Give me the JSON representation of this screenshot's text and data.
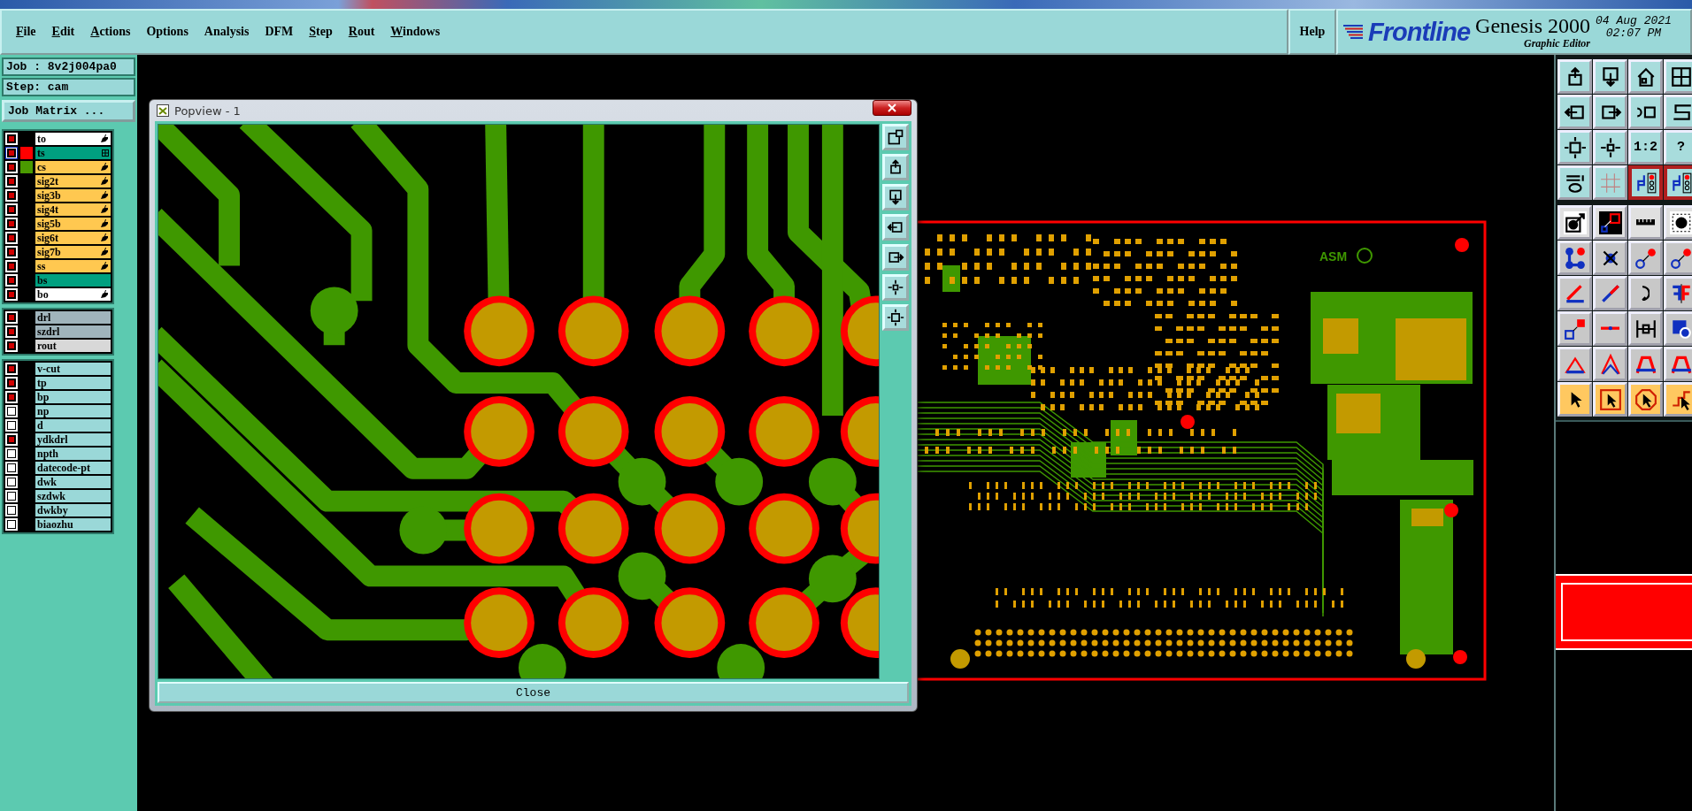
{
  "menu": {
    "items": [
      {
        "label": "File",
        "mnemonic": true
      },
      {
        "label": "Edit",
        "mnemonic": true
      },
      {
        "label": "Actions",
        "mnemonic": true
      },
      {
        "label": "Options",
        "mnemonic": false
      },
      {
        "label": "Analysis",
        "mnemonic": false
      },
      {
        "label": "DFM",
        "mnemonic": false
      },
      {
        "label": "Step",
        "mnemonic": true
      },
      {
        "label": "Rout",
        "mnemonic": true
      },
      {
        "label": "Windows",
        "mnemonic": true
      }
    ],
    "help": "Help"
  },
  "brand": {
    "logo": "Frontline",
    "product": "Genesis 2000",
    "module": "Graphic Editor",
    "date": "04 Aug 2021",
    "time": "02:07 PM"
  },
  "job": {
    "job_label": "Job : 8v2j004pa0",
    "step_label": "Step: cam",
    "matrix_button": "Job Matrix ..."
  },
  "layer_groups": [
    {
      "layers": [
        {
          "name": "to",
          "kind": "silk",
          "checked": true,
          "selected": false,
          "affected": true
        },
        {
          "name": "ts",
          "kind": "mask",
          "checked": true,
          "selected": true,
          "affected": false,
          "color": "#ff0000"
        },
        {
          "name": "cs",
          "kind": "signal",
          "checked": true,
          "selected": false,
          "affected": true,
          "color": "#4a9a00"
        },
        {
          "name": "sig2t",
          "kind": "signal",
          "checked": true,
          "selected": false,
          "affected": true
        },
        {
          "name": "sig3b",
          "kind": "signal",
          "checked": true,
          "selected": false,
          "affected": true
        },
        {
          "name": "sig4t",
          "kind": "signal",
          "checked": true,
          "selected": false,
          "affected": true
        },
        {
          "name": "sig5b",
          "kind": "signal",
          "checked": true,
          "selected": false,
          "affected": true
        },
        {
          "name": "sig6t",
          "kind": "signal",
          "checked": true,
          "selected": false,
          "affected": true
        },
        {
          "name": "sig7b",
          "kind": "signal",
          "checked": true,
          "selected": false,
          "affected": true
        },
        {
          "name": "ss",
          "kind": "signal",
          "checked": true,
          "selected": false,
          "affected": true
        },
        {
          "name": "bs",
          "kind": "mask",
          "checked": true,
          "selected": false,
          "affected": false
        },
        {
          "name": "bo",
          "kind": "silk",
          "checked": true,
          "selected": false,
          "affected": true
        }
      ]
    },
    {
      "layers": [
        {
          "name": "drl",
          "kind": "drill",
          "checked": true,
          "selected": false,
          "affected": false
        },
        {
          "name": "szdrl",
          "kind": "drill",
          "checked": true,
          "selected": false,
          "affected": false
        },
        {
          "name": "rout",
          "kind": "rout",
          "checked": true,
          "selected": false,
          "affected": false
        }
      ]
    },
    {
      "layers": [
        {
          "name": "v-cut",
          "kind": "document",
          "checked": true,
          "selected": false,
          "affected": false
        },
        {
          "name": "tp",
          "kind": "document",
          "checked": true,
          "selected": false,
          "affected": false
        },
        {
          "name": "bp",
          "kind": "document",
          "checked": true,
          "selected": false,
          "affected": false
        },
        {
          "name": "np",
          "kind": "document",
          "checked": false,
          "selected": false,
          "affected": false
        },
        {
          "name": "d",
          "kind": "document",
          "checked": false,
          "selected": false,
          "affected": false
        },
        {
          "name": "ydkdrl",
          "kind": "document",
          "checked": true,
          "selected": false,
          "affected": false
        },
        {
          "name": "npth",
          "kind": "document",
          "checked": false,
          "selected": false,
          "affected": false
        },
        {
          "name": "datecode-pt",
          "kind": "document",
          "checked": false,
          "selected": false,
          "affected": false
        },
        {
          "name": "dwk",
          "kind": "document",
          "checked": false,
          "selected": false,
          "affected": false
        },
        {
          "name": "szdwk",
          "kind": "document",
          "checked": false,
          "selected": false,
          "affected": false
        },
        {
          "name": "dwkby",
          "kind": "document",
          "checked": false,
          "selected": false,
          "affected": false
        },
        {
          "name": "biaozhu",
          "kind": "document",
          "checked": false,
          "selected": false,
          "affected": false
        }
      ]
    }
  ],
  "popview": {
    "title": "Popview - 1",
    "close_button": "Close"
  },
  "board": {
    "marking": "ASM"
  },
  "toolbar": [
    {
      "kind": "view",
      "buttons": [
        {
          "active": false
        },
        {
          "active": false
        },
        {
          "active": false
        },
        {
          "active": false
        }
      ]
    },
    {
      "kind": "view",
      "buttons": [
        {
          "active": false
        },
        {
          "active": false
        },
        {
          "active": false
        },
        {
          "active": false
        }
      ]
    },
    {
      "kind": "view",
      "buttons": [
        {
          "active": false
        },
        {
          "active": false
        },
        {
          "active": false,
          "label": "1:2"
        },
        {
          "active": false,
          "label": "?"
        }
      ]
    },
    {
      "kind": "view",
      "buttons": [
        {
          "active": false
        },
        {
          "active": false
        },
        {
          "active": true
        },
        {
          "active": true
        }
      ]
    },
    {
      "kind": "display",
      "buttons": [
        {
          "active": false
        },
        {
          "active": false
        },
        {
          "active": false
        },
        {
          "active": false
        }
      ]
    },
    {
      "kind": "edit",
      "buttons": [
        {
          "active": false
        },
        {
          "active": false
        },
        {
          "active": false
        },
        {
          "active": false
        }
      ]
    },
    {
      "kind": "edit",
      "buttons": [
        {
          "active": false
        },
        {
          "active": false
        },
        {
          "active": false
        },
        {
          "active": false
        }
      ]
    },
    {
      "kind": "edit",
      "buttons": [
        {
          "active": false
        },
        {
          "active": false
        },
        {
          "active": false
        },
        {
          "active": false
        }
      ]
    },
    {
      "kind": "edit",
      "buttons": [
        {
          "active": false
        },
        {
          "active": false
        },
        {
          "active": false
        },
        {
          "active": false
        }
      ]
    },
    {
      "kind": "select",
      "buttons": [
        {
          "active": false
        },
        {
          "active": false
        },
        {
          "active": false
        },
        {
          "active": false
        }
      ]
    }
  ]
}
